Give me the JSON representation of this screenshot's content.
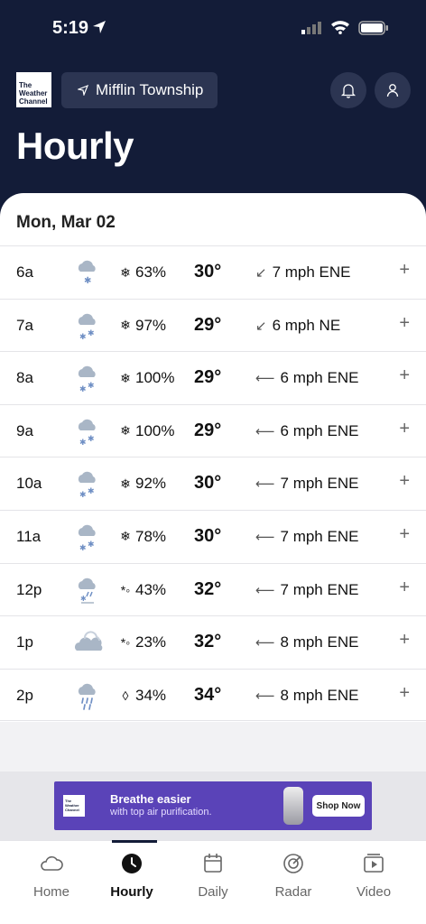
{
  "status_bar": {
    "time": "5:19"
  },
  "header": {
    "logo_text": "The Weather Channel",
    "location": "Mifflin Township",
    "title": "Hourly"
  },
  "day": {
    "date": "Mon, Mar 02"
  },
  "hours": [
    {
      "time": "6a",
      "icon": "snow-light-icon",
      "precip_icon": "❄",
      "precip": "63%",
      "temp": "30°",
      "wind_arrow": "↙",
      "wind": "7 mph ENE"
    },
    {
      "time": "7a",
      "icon": "snow-icon",
      "precip_icon": "❄",
      "precip": "97%",
      "temp": "29°",
      "wind_arrow": "↙",
      "wind": "6 mph NE"
    },
    {
      "time": "8a",
      "icon": "snow-icon",
      "precip_icon": "❄",
      "precip": "100%",
      "temp": "29°",
      "wind_arrow": "⟵",
      "wind": "6 mph ENE"
    },
    {
      "time": "9a",
      "icon": "snow-icon",
      "precip_icon": "❄",
      "precip": "100%",
      "temp": "29°",
      "wind_arrow": "⟵",
      "wind": "6 mph ENE"
    },
    {
      "time": "10a",
      "icon": "snow-icon",
      "precip_icon": "❄",
      "precip": "92%",
      "temp": "30°",
      "wind_arrow": "⟵",
      "wind": "7 mph ENE"
    },
    {
      "time": "11a",
      "icon": "snow-icon",
      "precip_icon": "❄",
      "precip": "78%",
      "temp": "30°",
      "wind_arrow": "⟵",
      "wind": "7 mph ENE"
    },
    {
      "time": "12p",
      "icon": "wintry-mix-icon",
      "precip_icon": "*◦",
      "precip": "43%",
      "temp": "32°",
      "wind_arrow": "⟵",
      "wind": "7 mph ENE"
    },
    {
      "time": "1p",
      "icon": "cloudy-icon",
      "precip_icon": "*◦",
      "precip": "23%",
      "temp": "32°",
      "wind_arrow": "⟵",
      "wind": "8 mph ENE"
    },
    {
      "time": "2p",
      "icon": "rain-icon",
      "precip_icon": "◊",
      "precip": "34%",
      "temp": "34°",
      "wind_arrow": "⟵",
      "wind": "8 mph ENE"
    }
  ],
  "expand_symbol": "+",
  "ad": {
    "logo_text": "The Weather Channel",
    "headline": "Breathe easier",
    "subline": "with top air purification.",
    "cta": "Shop Now"
  },
  "tabs": [
    {
      "label": "Home",
      "icon": "cloud-icon"
    },
    {
      "label": "Hourly",
      "icon": "clock-icon",
      "active": true
    },
    {
      "label": "Daily",
      "icon": "calendar-icon"
    },
    {
      "label": "Radar",
      "icon": "radar-icon"
    },
    {
      "label": "Video",
      "icon": "video-icon"
    }
  ],
  "colors": {
    "header_bg": "#131c38",
    "pill_bg": "#2c3552",
    "ad_bg": "#5a43b8"
  }
}
